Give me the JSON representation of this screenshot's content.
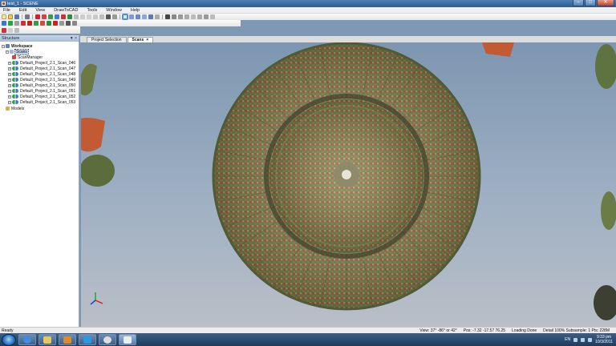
{
  "window": {
    "title": "test_1 - SCENE"
  },
  "menu": [
    "File",
    "Edit",
    "View",
    "DrawToCAD",
    "Tools",
    "Window",
    "Help"
  ],
  "structure_panel": {
    "title": "Structure",
    "pin": "▼ ×",
    "workspace_label": "Workspace",
    "scans_label": "Scans",
    "scan_manager_label": "ScanManager",
    "scans": [
      "Default_Project_2.1_Scan_046",
      "Default_Project_2.1_Scan_047",
      "Default_Project_2.1_Scan_048",
      "Default_Project_2.1_Scan_049",
      "Default_Project_2.1_Scan_050",
      "Default_Project_2.1_Scan_051",
      "Default_Project_2.1_Scan_052",
      "Default_Project_2.1_Scan_053"
    ],
    "models_label": "Models"
  },
  "tabs": [
    {
      "label": "Project Selection",
      "closable": false
    },
    {
      "label": "Scans",
      "closable": true
    }
  ],
  "tab_close": "×",
  "status": {
    "left": "Ready",
    "view": "View: 37° -86° or 42°",
    "pos": "Pos: -7.32 -17.57 76.25",
    "loading": "Loading Done",
    "detail": "Detail 100%  Subsample: 1   Pts: 228M"
  },
  "tray": {
    "lang": "EN",
    "time": "9:33 pm",
    "date": "10/3/2011"
  },
  "colors": {
    "accent": "#2c5d93",
    "scan_green": "#2aa24a",
    "scan_blue": "#3a78d4"
  }
}
